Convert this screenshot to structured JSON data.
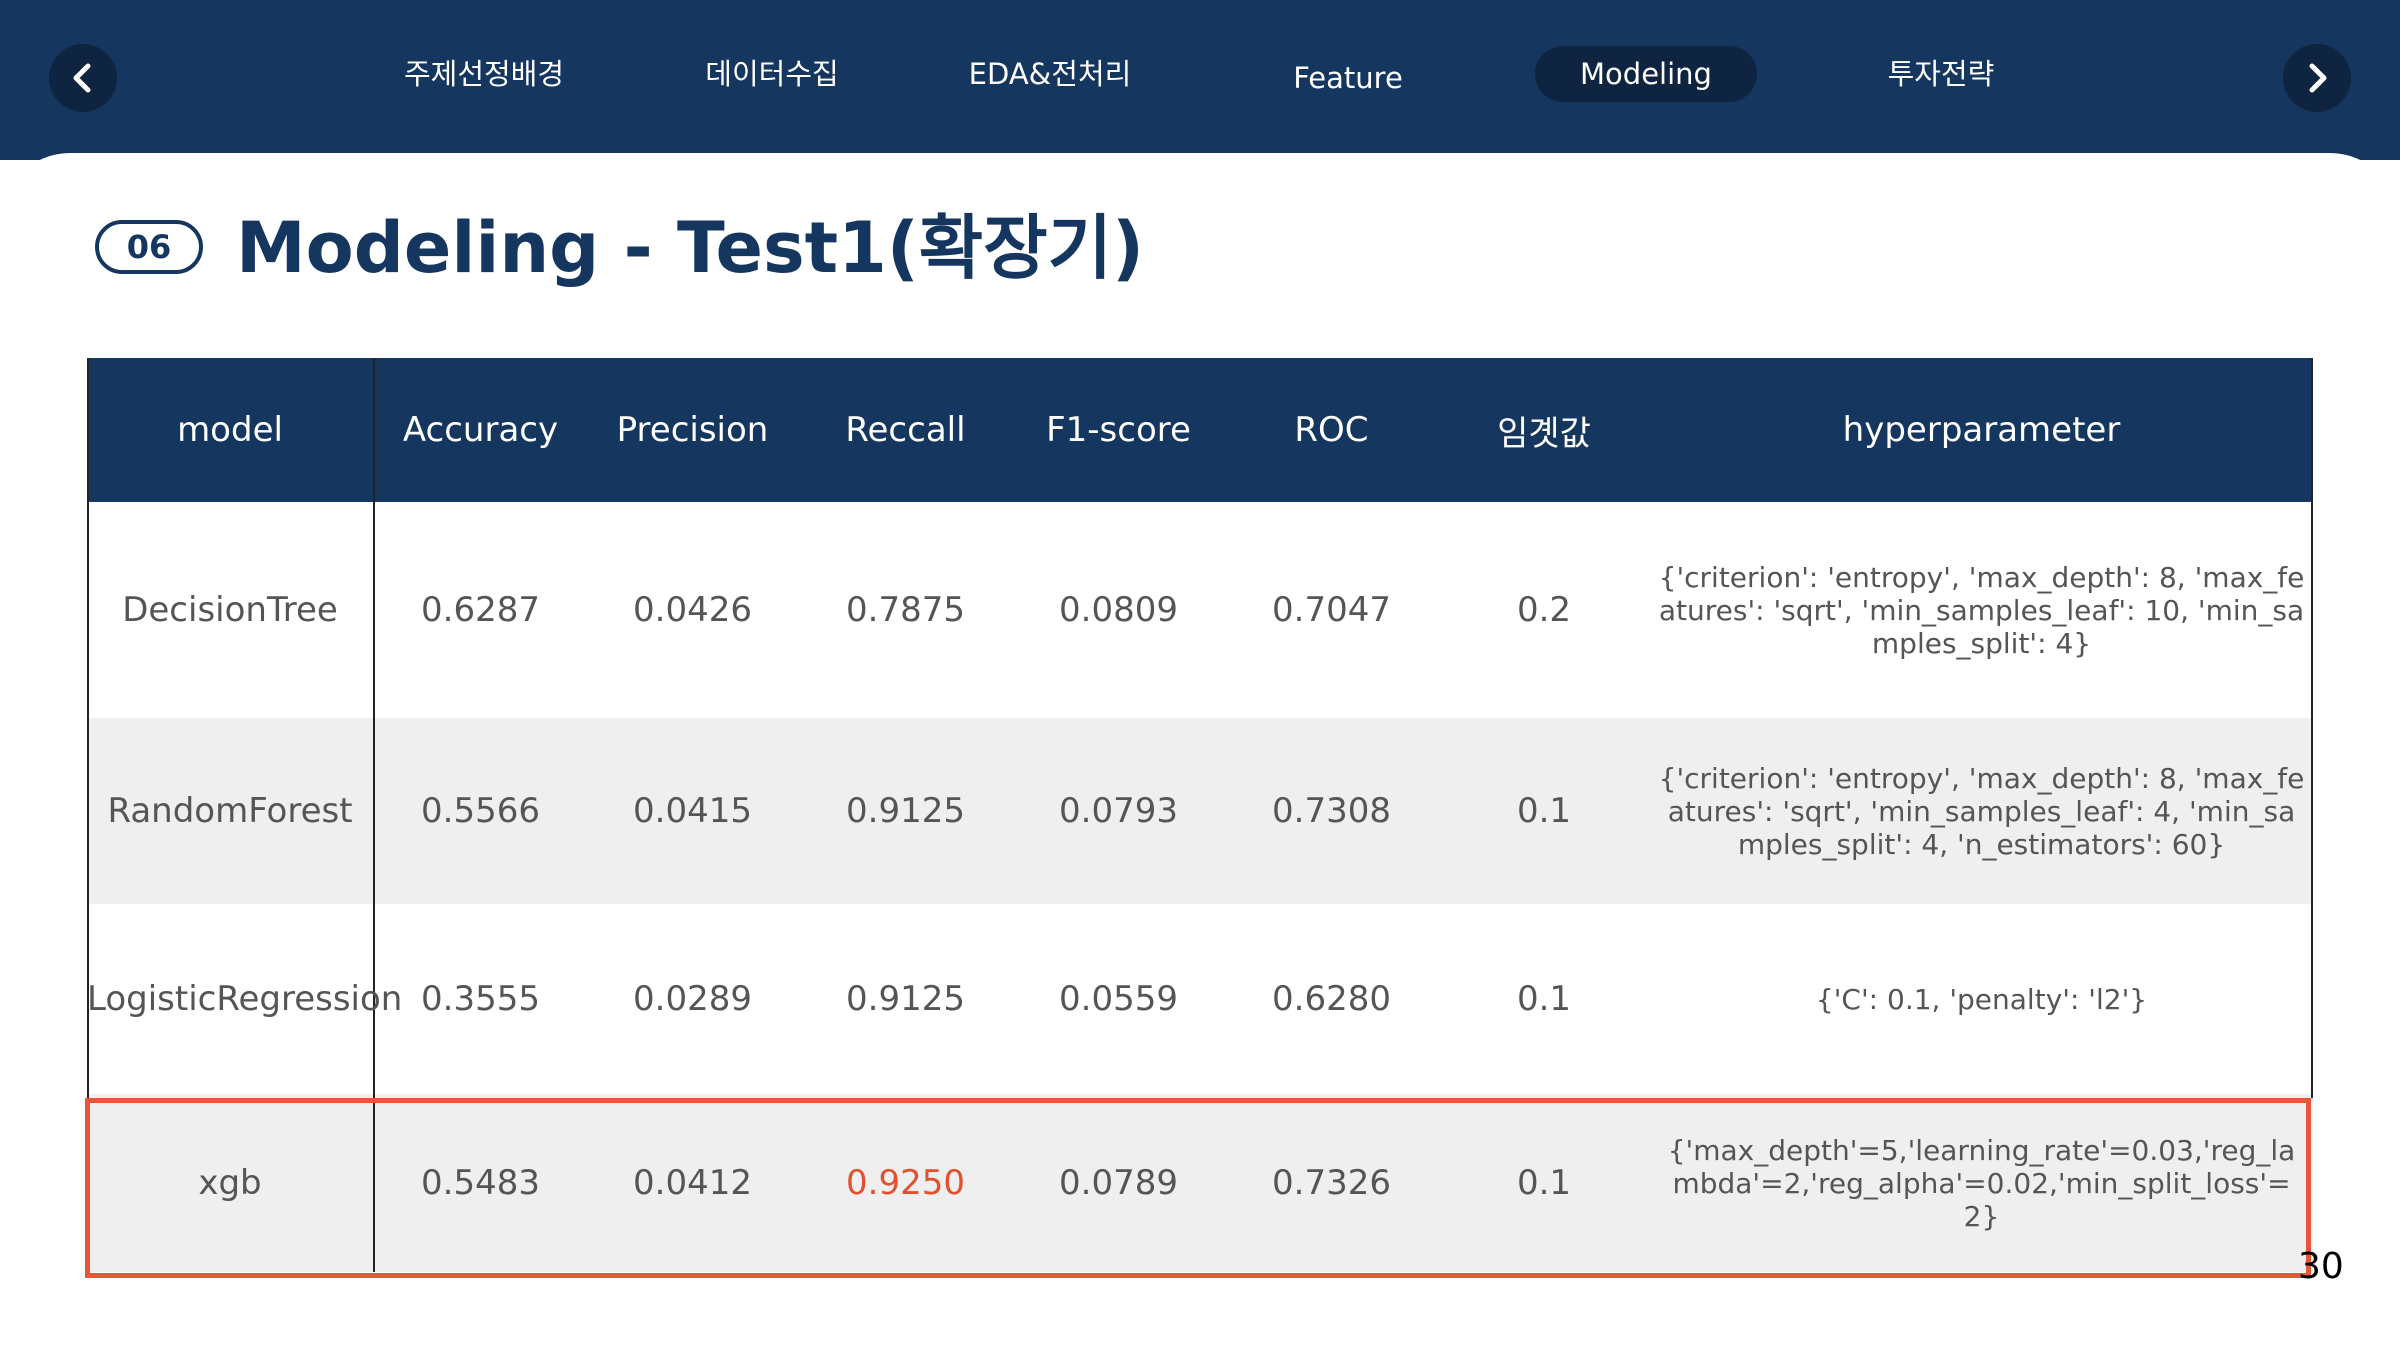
{
  "nav": {
    "tabs": [
      {
        "label": "주제선정배경",
        "active": false
      },
      {
        "label": "데이터수집",
        "active": false
      },
      {
        "label": "EDA&전처리",
        "active": false
      },
      {
        "label": "Feature",
        "active": false
      },
      {
        "label": "Modeling",
        "active": true
      },
      {
        "label": "투자전략",
        "active": false
      }
    ],
    "prev_icon": "chevron-left-icon",
    "next_icon": "chevron-right-icon"
  },
  "section": {
    "number": "06",
    "title": "Modeling - Test1(확장기)"
  },
  "table": {
    "headers": [
      "model",
      "Accuracy",
      "Precision",
      "Reccall",
      "F1-score",
      "ROC",
      "임곗값",
      "hyperparameter"
    ],
    "rows": [
      [
        "DecisionTree",
        "0.6287",
        "0.0426",
        "0.7875",
        "0.0809",
        "0.7047",
        "0.2",
        "{'criterion': 'entropy', 'max_depth': 8, 'max_features': 'sqrt', 'min_samples_leaf': 10, 'min_samples_split': 4}"
      ],
      [
        "RandomForest",
        "0.5566",
        "0.0415",
        "0.9125",
        "0.0793",
        "0.7308",
        "0.1",
        "{'criterion': 'entropy', 'max_depth': 8, 'max_features': 'sqrt', 'min_samples_leaf': 4, 'min_samples_split': 4, 'n_estimators': 60}"
      ],
      [
        "LogisticRegression",
        "0.3555",
        "0.0289",
        "0.9125",
        "0.0559",
        "0.6280",
        "0.1",
        "{'C': 0.1, 'penalty': 'l2'}"
      ],
      [
        "xgb",
        "0.5483",
        "0.0412",
        "0.9250",
        "0.0789",
        "0.7326",
        "0.1",
        "{'max_depth'=5,'learning_rate'=0.03,'reg_lambda'=2,'reg_alpha'=0.02,'min_split_loss'=2}"
      ]
    ]
  },
  "colors": {
    "header_bg": "#15365f",
    "highlight": "#e8563a",
    "best_value": "#e3502b"
  },
  "page_number": "30"
}
